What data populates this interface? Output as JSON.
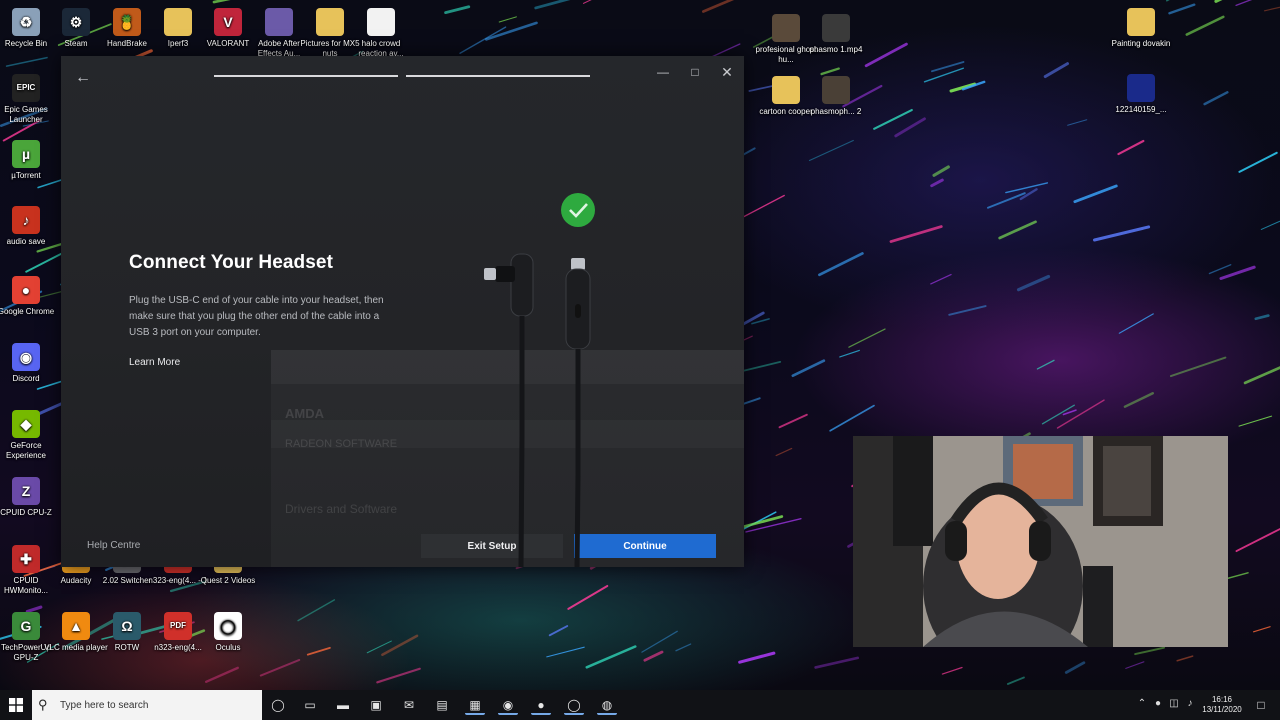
{
  "desktop": {
    "left_icons": [
      {
        "label": "Recycle Bin",
        "icon": "recycle-bin-icon",
        "color": "#8aa0b8",
        "glyph": "♻"
      },
      {
        "label": "Steam",
        "icon": "steam-icon",
        "color": "#1b2838",
        "glyph": "⚙"
      },
      {
        "label": "HandBrake",
        "icon": "handbrake-icon",
        "color": "#c05a1a",
        "glyph": "🍍"
      },
      {
        "label": "Iperf3",
        "icon": "folder-icon",
        "color": "#e7c25a",
        "glyph": ""
      },
      {
        "label": "VALORANT",
        "icon": "valorant-icon",
        "color": "#c0253b",
        "glyph": "V"
      },
      {
        "label": "Adobe After Effects Au...",
        "icon": "file-icon",
        "color": "#6b5aa8",
        "glyph": ""
      },
      {
        "label": "Pictures for MX5 nuts",
        "icon": "folder-icon",
        "color": "#e7c25a",
        "glyph": ""
      },
      {
        "label": "halo crowd reaction av...",
        "icon": "document-icon",
        "color": "#f2f2f2",
        "glyph": ""
      },
      {
        "label": "Epic Games Launcher",
        "icon": "epic-games-icon",
        "color": "#222222",
        "glyph": "EPIC"
      },
      {
        "label": "µTorrent",
        "icon": "utorrent-icon",
        "color": "#4aa53a",
        "glyph": "µ"
      },
      {
        "label": "audio save",
        "icon": "audio-icon",
        "color": "#c8321e",
        "glyph": "♪"
      },
      {
        "label": "Google Chrome",
        "icon": "chrome-icon",
        "color": "#e34133",
        "glyph": "●"
      },
      {
        "label": "Discord",
        "icon": "discord-icon",
        "color": "#5865f2",
        "glyph": "◉"
      },
      {
        "label": "GeForce Experience",
        "icon": "geforce-icon",
        "color": "#76b900",
        "glyph": "◆"
      },
      {
        "label": "CPUID CPU-Z",
        "icon": "cpuz-icon",
        "color": "#6a4aa8",
        "glyph": "Z"
      },
      {
        "label": "CPUID HWMonito...",
        "icon": "hwmonitor-icon",
        "color": "#c02a2a",
        "glyph": "✚"
      },
      {
        "label": "Audacity",
        "icon": "audacity-icon",
        "color": "#f0a020",
        "glyph": "♫"
      },
      {
        "label": "2.02 Switcher",
        "icon": "switcher-icon",
        "color": "#6a6a70",
        "glyph": "⇄"
      },
      {
        "label": "n323-eng(4... - 1",
        "icon": "pdf-icon",
        "color": "#d0302a",
        "glyph": ""
      },
      {
        "label": "Quest 2 Videos",
        "icon": "folder-icon",
        "color": "#e7c25a",
        "glyph": ""
      },
      {
        "label": "TechPowerUp GPU-Z",
        "icon": "gpuz-icon",
        "color": "#3a8a3a",
        "glyph": "G"
      },
      {
        "label": "VLC media player",
        "icon": "vlc-icon",
        "color": "#f08a10",
        "glyph": "▲"
      },
      {
        "label": "ROTW",
        "icon": "rotw-icon",
        "color": "#2a5a6a",
        "glyph": "Ω"
      },
      {
        "label": "n323-eng(4...",
        "icon": "pdf-icon",
        "color": "#d0302a",
        "glyph": "PDF"
      },
      {
        "label": "Oculus",
        "icon": "oculus-icon",
        "color": "#ffffff",
        "glyph": "◯"
      }
    ],
    "right_icons": [
      {
        "label": "profesional ghost hu...",
        "icon": "video-thumbnail-icon",
        "color": "#5a4a3a"
      },
      {
        "label": "phasmo 1.mp4",
        "icon": "video-thumbnail-icon",
        "color": "#3a3a3a"
      },
      {
        "label": "cartoon cooper",
        "icon": "folder-icon",
        "color": "#e7c25a"
      },
      {
        "label": "phasmoph... 2",
        "icon": "video-thumbnail-icon",
        "color": "#4a4036"
      },
      {
        "label": "Painting dovakin",
        "icon": "folder-icon",
        "color": "#e7c25a"
      },
      {
        "label": "122140159_...",
        "icon": "image-thumbnail-icon",
        "color": "#1a2a8a"
      }
    ]
  },
  "setup": {
    "title": "Connect Your Headset",
    "description": "Plug the USB-C end of your cable into your headset, then make sure that you plug the other end of the cable into a USB 3 port on your computer.",
    "learn_more": "Learn More",
    "help_centre": "Help Centre",
    "exit_setup": "Exit Setup",
    "continue": "Continue",
    "accent_color": "#1f6bd1",
    "success_color": "#2eaa3f",
    "progress_steps": 2,
    "ghost_brand": "AMDA",
    "ghost_title": "RADEON SOFTWARE",
    "ghost_heading": "Drivers and Software"
  },
  "taskbar": {
    "search_placeholder": "Type here to search",
    "apps": [
      {
        "name": "task-view-icon",
        "glyph": "▭"
      },
      {
        "name": "file-explorer-icon",
        "glyph": "▬"
      },
      {
        "name": "store-icon",
        "glyph": "▣"
      },
      {
        "name": "mail-icon",
        "glyph": "✉"
      },
      {
        "name": "app-icon",
        "glyph": "▤"
      },
      {
        "name": "voicemeeter-icon",
        "glyph": "▦"
      },
      {
        "name": "discord-icon",
        "glyph": "◉"
      },
      {
        "name": "chrome-icon",
        "glyph": "●"
      },
      {
        "name": "oculus-icon",
        "glyph": "◯"
      },
      {
        "name": "obs-icon",
        "glyph": "◍"
      }
    ],
    "time": "16:16",
    "date": "13/11/2020"
  }
}
